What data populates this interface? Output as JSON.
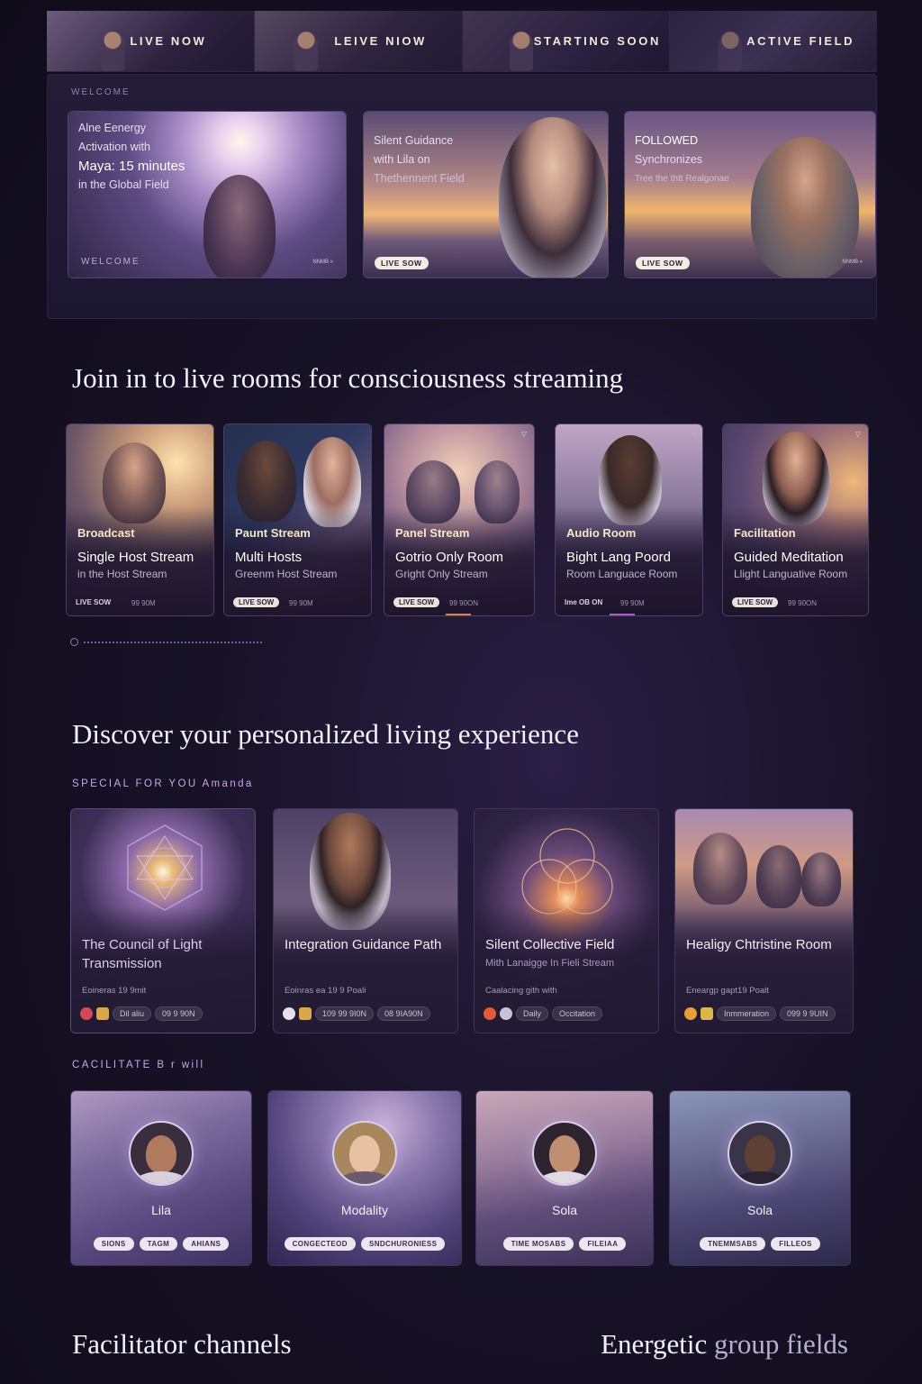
{
  "top_tabs": [
    {
      "label": "LIVE NOW"
    },
    {
      "label": "LEIVE NIOW"
    },
    {
      "label": "STARTING SOON"
    },
    {
      "label": "ACTIVE FIELD"
    }
  ],
  "welcome": {
    "eyebrow": "WELCOME",
    "cards": [
      {
        "line1": "Alne Eenergy",
        "line2": "Activation with",
        "line3": "Maya: 15 minutes",
        "line4": "in the Global Field",
        "footer": "WELCOME",
        "mini": "NNMB »"
      },
      {
        "line1": "Silent Guidance",
        "line2": "with Lila on",
        "line3": "Thethennent Field",
        "pill": "LIVE SOW"
      },
      {
        "line1": "FOLLOWED",
        "line2": "Synchronizes",
        "line3": "Tree the thtt Realgonae",
        "pill": "LIVE SOW",
        "mini": "NNMB »"
      }
    ]
  },
  "live_section": {
    "heading": "Join in to live rooms for consciousness streaming"
  },
  "rooms": [
    {
      "category": "Broadcast",
      "title": "Single Host Stream",
      "subtitle": "in the Host Stream",
      "pill": "LIVE SOW",
      "time": "99 90M",
      "corner": "·"
    },
    {
      "category": "Paunt Stream",
      "title": "Multi Hosts",
      "subtitle": "Greenm Host Stream",
      "pill": "LIVE SOW",
      "time": "99 90M",
      "corner": "·"
    },
    {
      "category": "Panel Stream",
      "title": "Gotrio Only Room",
      "subtitle": "Gright Only Stream",
      "pill": "LIVE SOW",
      "time": "99 90ON",
      "corner": "▽"
    },
    {
      "category": "Audio Room",
      "title": "Bight Lang Poord",
      "subtitle": "Room Languace Room",
      "pill": "Ime OB ON",
      "time": "99 90M",
      "corner": "·"
    },
    {
      "category": "Facilitation",
      "title": "Guided Meditation",
      "subtitle": "Llight Languative Room",
      "pill": "LIVE SOW",
      "time": "99 90ON",
      "corner": "▽"
    }
  ],
  "discover_section": {
    "heading": "Discover your personalized living experience",
    "eyebrow": "SPECIAL FOR YOU Amanda"
  },
  "discover_cards": [
    {
      "title": "The Council of Light Transmission",
      "meta": "Eoineras 19 9mit",
      "chips": [
        "Dil aliu",
        "09 9 90N"
      ]
    },
    {
      "title": "Integration Guidance Path",
      "meta": "Eoinras ea 19 9 Poali",
      "chips": [
        "109 99 9I0N",
        "08 9IA90N"
      ]
    },
    {
      "title": "Silent Collective Field",
      "subtitle": "Mith Lanaigge In Fieli Stream",
      "meta": "Caalacing gith with",
      "chips": [
        "Daily",
        "Occitation"
      ]
    },
    {
      "title": "Healigy Chtristine Room",
      "meta": "Eneargp gapt19 Poalt",
      "chips": [
        "Inmmeration",
        "099 9 9UIN"
      ]
    }
  ],
  "facilitate_section": {
    "eyebrow": "CACILITATE B r will"
  },
  "facilitators": [
    {
      "name": "Lila",
      "tags": [
        "SIONS",
        "TAGM",
        "AHIANS"
      ]
    },
    {
      "name": "Modality",
      "tags": [
        "CONGECTEOD",
        "SNDCHURONIESS"
      ]
    },
    {
      "name": "Sola",
      "tags": [
        "TIME MOSABS",
        "FILEIAA"
      ]
    },
    {
      "name": "Sola",
      "tags": [
        "TNEMMSABS",
        "FILLEOS"
      ]
    }
  ],
  "footer": {
    "left": "Facilitator channels",
    "right_strong": "Energetic",
    "right_soft": "group fields"
  },
  "colors": {
    "background": "#171226",
    "accent": "#c8a6ea",
    "pill": "#ece6f0",
    "card_border": "#4b3f66"
  }
}
